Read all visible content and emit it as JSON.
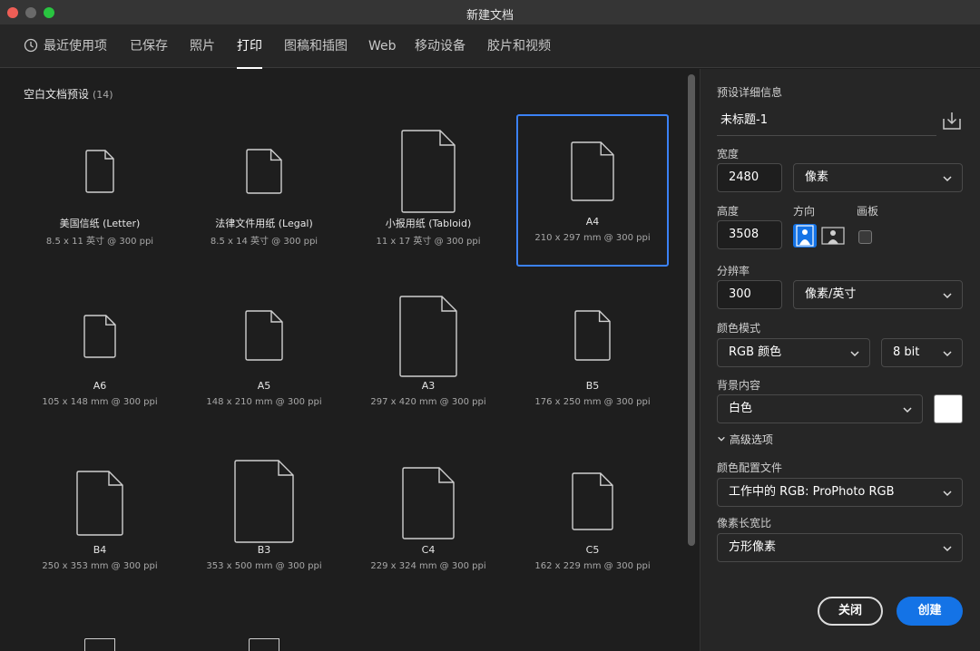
{
  "window": {
    "title": "新建文档"
  },
  "tabs": [
    {
      "label": "最近使用项",
      "icon": "clock-icon"
    },
    {
      "label": "已保存"
    },
    {
      "label": "照片"
    },
    {
      "label": "打印",
      "active": true
    },
    {
      "label": "图稿和插图"
    },
    {
      "label": "Web"
    },
    {
      "label": "移动设备"
    },
    {
      "label": "胶片和视频"
    }
  ],
  "presets": {
    "section_title": "空白文档预设",
    "count": "(14)",
    "items": [
      {
        "name": "美国信纸 (Letter)",
        "size": "8.5 x 11 英寸 @ 300 ppi"
      },
      {
        "name": "法律文件用纸 (Legal)",
        "size": "8.5 x 14 英寸 @ 300 ppi"
      },
      {
        "name": "小报用纸 (Tabloid)",
        "size": "11 x 17 英寸 @ 300 ppi"
      },
      {
        "name": "A4",
        "size": "210 x 297 mm @ 300 ppi",
        "selected": true
      },
      {
        "name": "A6",
        "size": "105 x 148 mm @ 300 ppi"
      },
      {
        "name": "A5",
        "size": "148 x 210 mm @ 300 ppi"
      },
      {
        "name": "A3",
        "size": "297 x 420 mm @ 300 ppi"
      },
      {
        "name": "B5",
        "size": "176 x 250 mm @ 300 ppi"
      },
      {
        "name": "B4",
        "size": "250 x 353 mm @ 300 ppi"
      },
      {
        "name": "B3",
        "size": "353 x 500 mm @ 300 ppi"
      },
      {
        "name": "C4",
        "size": "229 x 324 mm @ 300 ppi"
      },
      {
        "name": "C5",
        "size": "162 x 229 mm @ 300 ppi"
      }
    ]
  },
  "details": {
    "header": "预设详细信息",
    "doc_name": "未标题-1",
    "width_label": "宽度",
    "width_value": "2480",
    "width_unit": "像素",
    "height_label": "高度",
    "height_value": "3508",
    "orientation_label": "方向",
    "artboard_label": "画板",
    "resolution_label": "分辨率",
    "resolution_value": "300",
    "resolution_unit": "像素/英寸",
    "color_mode_label": "颜色模式",
    "color_mode_value": "RGB 颜色",
    "bit_depth_value": "8 bit",
    "background_label": "背景内容",
    "background_value": "白色",
    "background_swatch": "#ffffff",
    "advanced_label": "高级选项",
    "color_profile_label": "颜色配置文件",
    "color_profile_value": "工作中的 RGB: ProPhoto RGB",
    "pixel_aspect_label": "像素长宽比",
    "pixel_aspect_value": "方形像素",
    "close_label": "关闭",
    "create_label": "创建"
  },
  "colors": {
    "accent": "#1473e6",
    "selection": "#3b82f6"
  }
}
